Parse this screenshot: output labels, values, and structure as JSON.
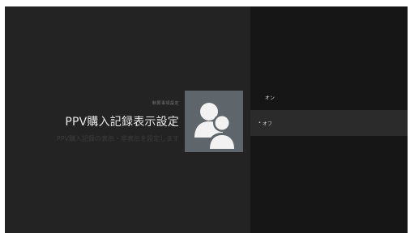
{
  "settings": {
    "breadcrumb": "制限事項設定",
    "title": "PPV購入記録表示設定",
    "description": "PPV購入記録の表示・非表示を設定します"
  },
  "icon": {
    "name": "account-icon",
    "tile_color": "#5f666b"
  },
  "options": [
    {
      "label": "オン",
      "selected": false
    },
    {
      "label": "オフ",
      "selected": true,
      "marker": "•"
    }
  ],
  "colors": {
    "background": "#222222",
    "options_panel": "#161616",
    "selected_row": "#2b2b2b"
  }
}
